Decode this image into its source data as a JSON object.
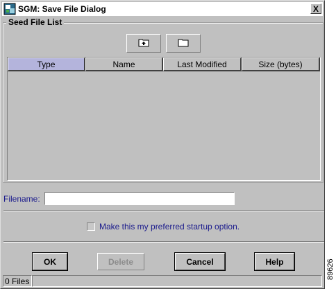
{
  "window": {
    "title": "SGM: Save File Dialog",
    "close_label": "X"
  },
  "seed_file_list": {
    "label": "Seed File List",
    "columns": [
      "Type",
      "Name",
      "Last Modified",
      "Size (bytes)"
    ],
    "selected_column": "Type",
    "rows": []
  },
  "toolbar": {
    "up_folder_icon": "folder-up-icon",
    "new_folder_icon": "folder-icon"
  },
  "filename": {
    "label": "Filename:",
    "value": ""
  },
  "preferred_option": {
    "label": "Make this my preferred startup option.",
    "checked": false
  },
  "buttons": {
    "ok": "OK",
    "delete": "Delete",
    "cancel": "Cancel",
    "help": "Help"
  },
  "status": {
    "file_count": "0 Files"
  },
  "figure_code": "89626",
  "colors": {
    "window_bg": "#c0c0c0",
    "selected_header": "#b4b4dc",
    "label_blue": "#1a1a8c"
  }
}
